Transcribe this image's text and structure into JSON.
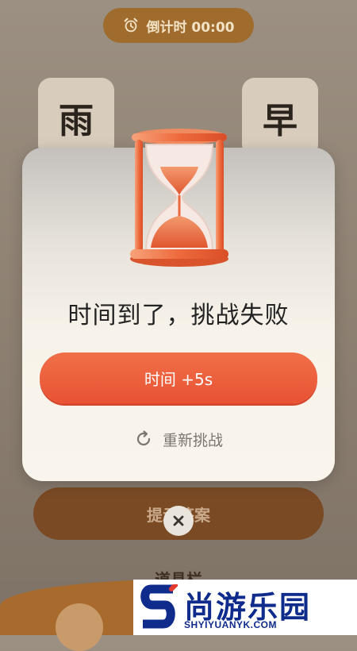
{
  "timer": {
    "label": "倒计时 00:00",
    "icon": "alarm-clock-icon"
  },
  "tiles": [
    {
      "char": "雨"
    },
    {
      "char": "早"
    }
  ],
  "background": {
    "hint_button": "提示答案",
    "props_label": "道具栏"
  },
  "dialog": {
    "illustration": "hourglass-icon",
    "title": "时间到了，挑战失败",
    "add_time_button": "时间 +5s",
    "retry_label": "重新挑战",
    "retry_icon": "refresh-icon",
    "close_icon": "close-icon"
  },
  "watermark": {
    "name": "尚游乐园",
    "url": "SHYIYUANYK.COM"
  },
  "colors": {
    "accent": "#e95233",
    "brand_blue": "#0f2c8c",
    "timer_bg": "#a06c2e"
  }
}
